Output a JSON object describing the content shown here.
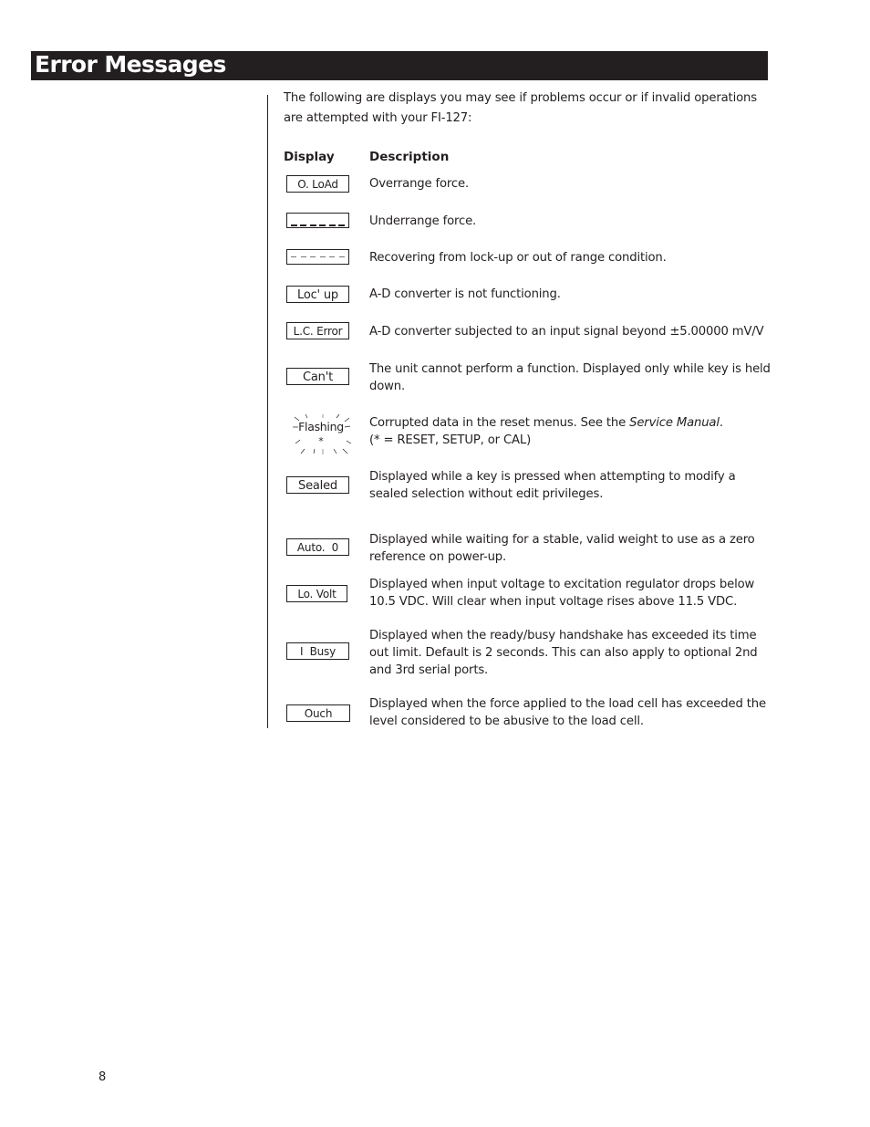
{
  "header": {
    "title": "Error Messages"
  },
  "intro": "The following are displays you may see if problems occur or if invalid operations are attempted with your FI-127:",
  "table": {
    "columns": [
      "Display",
      "Description"
    ],
    "rows": [
      {
        "display": "O. LoAd",
        "display_style": "text",
        "description": "Overrange force."
      },
      {
        "display": "",
        "display_style": "low-dashes",
        "description": "Underrange force."
      },
      {
        "display": "",
        "display_style": "mid-dashes",
        "description": "Recovering from lock-up or out of range condition."
      },
      {
        "display": "Loc' up",
        "display_style": "text",
        "description": "A-D converter is not functioning."
      },
      {
        "display": "L.C. Error",
        "display_style": "text",
        "description": "A-D converter subjected to an input signal beyond ±5.00000 mV/V"
      },
      {
        "display": "Can't",
        "display_style": "text",
        "description": "The unit cannot perform a function. Displayed only while key is held down."
      },
      {
        "display": "Flashing",
        "display_sub": "*",
        "display_style": "flashing",
        "description_pre": "Corrupted data in the reset menus. See the ",
        "description_italic": "Service Manual",
        "description_post": ".",
        "description_line2": "(* = RESET, SETUP, or CAL)"
      },
      {
        "display": "Sealed",
        "display_style": "text",
        "description": "Displayed while a key is pressed when attempting to modify a sealed selection without edit privileges."
      },
      {
        "display": "Auto.  0",
        "display_style": "text",
        "description": "Displayed while waiting for a stable, valid weight to use as a zero reference on power-up."
      },
      {
        "display": "Lo. Volt",
        "display_style": "text",
        "description": "Displayed when input voltage to excitation regulator drops below 10.5 VDC. Will clear when input voltage rises above 11.5 VDC."
      },
      {
        "display": "I  Busy",
        "display_style": "text",
        "description": "Displayed when the ready/busy handshake has exceeded its time out limit. Default is 2 seconds. This can also apply to optional 2nd and 3rd serial ports."
      },
      {
        "display": "Ouch",
        "display_style": "text",
        "description": "Displayed when the force applied to the load cell has exceeded the level considered to be abusive to the load cell."
      }
    ]
  },
  "footer": {
    "page_number": "8"
  }
}
